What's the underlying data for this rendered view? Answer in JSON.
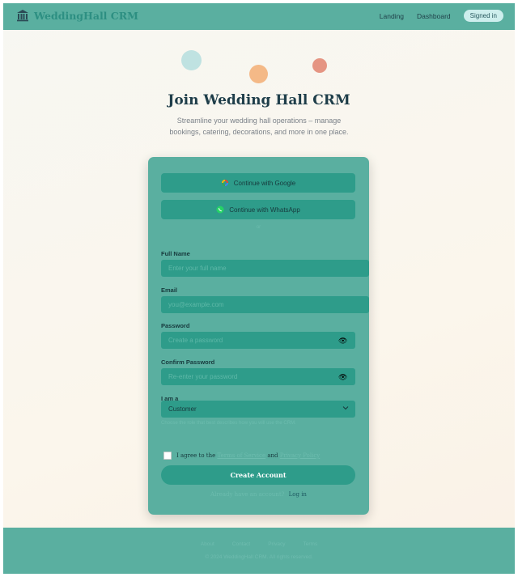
{
  "header": {
    "brand": "WeddingHall CRM",
    "nav": {
      "landing": "Landing",
      "dashboard": "Dashboard",
      "status": "Signed in"
    }
  },
  "hero": {
    "title": "Join Wedding Hall CRM",
    "subtitle": "Streamline your wedding hall operations – manage bookings, catering, decorations, and more in one place."
  },
  "form": {
    "google_label": "Continue with Google",
    "whatsapp_label": "Continue with WhatsApp",
    "divider": "or",
    "full_name": {
      "label": "Full Name",
      "placeholder": "Enter your full name"
    },
    "email": {
      "label": "Email",
      "placeholder": "you@example.com"
    },
    "password": {
      "label": "Password",
      "placeholder": "Create a password"
    },
    "confirm": {
      "label": "Confirm Password",
      "placeholder": "Re-enter your password"
    },
    "role": {
      "label": "I am a",
      "selected": "Customer"
    },
    "role_hint": "Choose the role that best describes how you will use the CRM.",
    "agree": {
      "prefix": "I agree to the",
      "terms": "Terms of Service",
      "and": "and",
      "privacy": "Privacy Policy"
    },
    "submit": "Create Account",
    "login_prompt": "Already have an account?",
    "login_link": "Log in"
  },
  "footer": {
    "links": [
      "About",
      "Contact",
      "Privacy",
      "Terms"
    ],
    "copyright": "© 2024 WeddingHall CRM. All rights reserved."
  },
  "colors": {
    "primary": "#5aafa0",
    "primary_dark": "#2e9c8a",
    "heading": "#1e3d49",
    "background": "#f8f5ee"
  },
  "icons": [
    "building-icon",
    "google-icon",
    "whatsapp-icon",
    "eye-icon",
    "chevron-down-icon"
  ]
}
